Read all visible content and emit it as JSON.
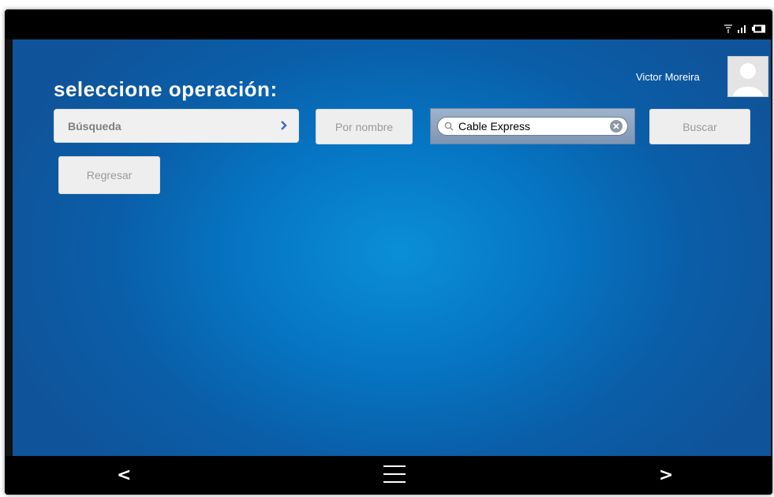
{
  "screen": {
    "title": "seleccione operación:",
    "user": {
      "name": "Victor Moreira"
    },
    "operation_select": {
      "label": "Búsqueda"
    },
    "buttons": {
      "by_name": "Por nombre",
      "search": "Buscar",
      "back": "Regresar"
    },
    "search": {
      "value": "Cable Express"
    }
  },
  "navbar": {
    "back": "<",
    "forward": ">"
  },
  "icons": [
    "wifi-icon",
    "signal-icon",
    "battery-icon",
    "chevron-right-icon",
    "search-icon",
    "clear-icon",
    "avatar-icon",
    "menu-icon"
  ],
  "colors": {
    "background": "#0a6fbf",
    "accent": "#3f6fb5",
    "button_bg": "#eeeeef"
  }
}
